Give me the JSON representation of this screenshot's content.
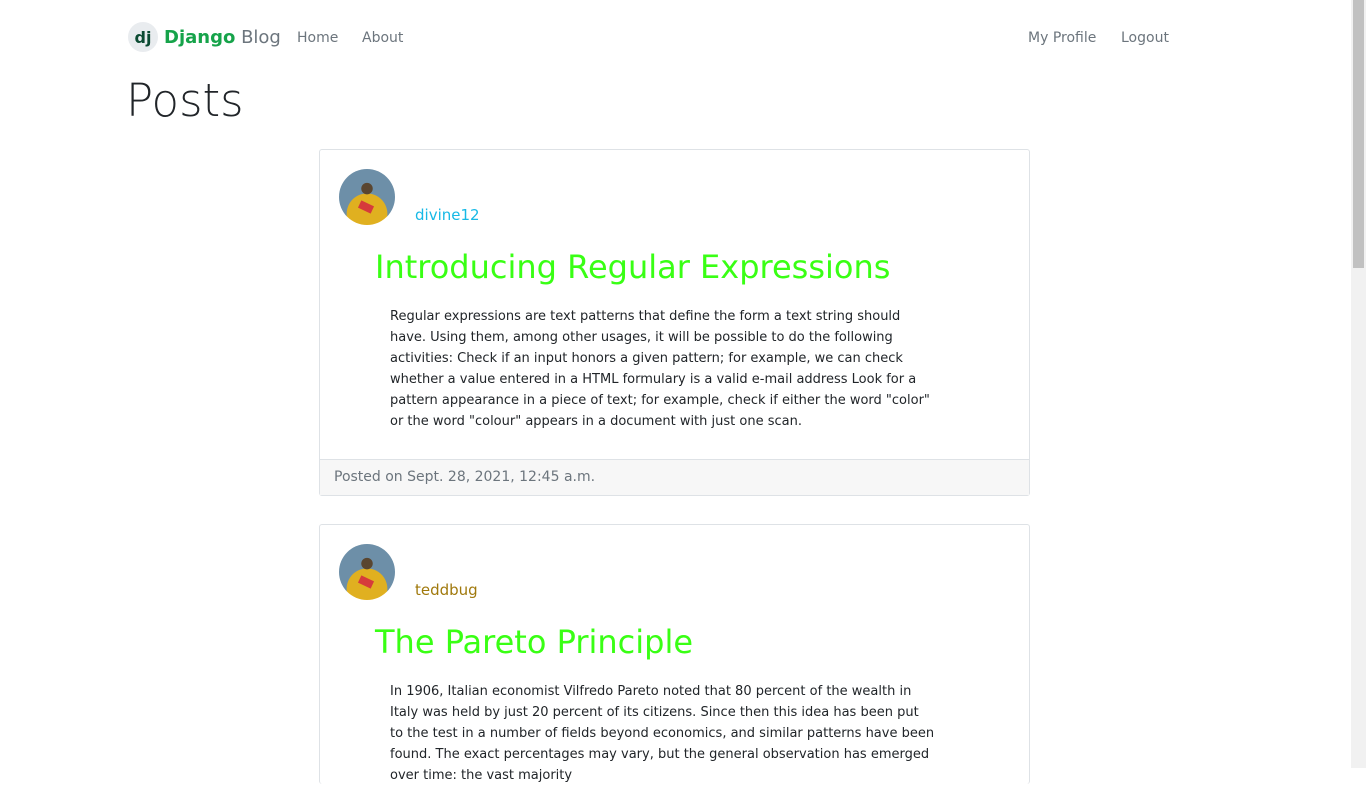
{
  "navbar": {
    "brand_logo": "dj",
    "brand_django": "Django",
    "brand_blog": "Blog",
    "links": [
      "Home",
      "About"
    ],
    "right_links": [
      "My Profile",
      "Logout"
    ]
  },
  "page_title": "Posts",
  "posts": [
    {
      "author": "divine12",
      "author_color": "#17b9e6",
      "title": "Introducing Regular Expressions",
      "body": "Regular expressions are text patterns that define the form a text string should have. Using them, among other usages, it will be possible to do the following activities: Check if an input honors a given pattern; for example, we can check whether a value entered in a HTML formulary is a valid e-mail address Look for a pattern appearance in a piece of text; for example, check if either the word \"color\" or the word \"colour\" appears in a document with just one scan.",
      "footer": "Posted on Sept. 28, 2021, 12:45 a.m."
    },
    {
      "author": "teddbug",
      "author_color": "#a0790c",
      "title": "The Pareto Principle",
      "body": "In 1906, Italian economist Vilfredo Pareto noted that 80 percent of the wealth in Italy was held by just 20 percent of its citizens. Since then this idea has been put to the test in a number of fields beyond economics, and similar patterns have been found. The exact percentages may vary, but the general observation has emerged over time: the vast majority"
    }
  ],
  "colors": {
    "title_green": "#39ff14",
    "brand_green": "#16a34a"
  }
}
